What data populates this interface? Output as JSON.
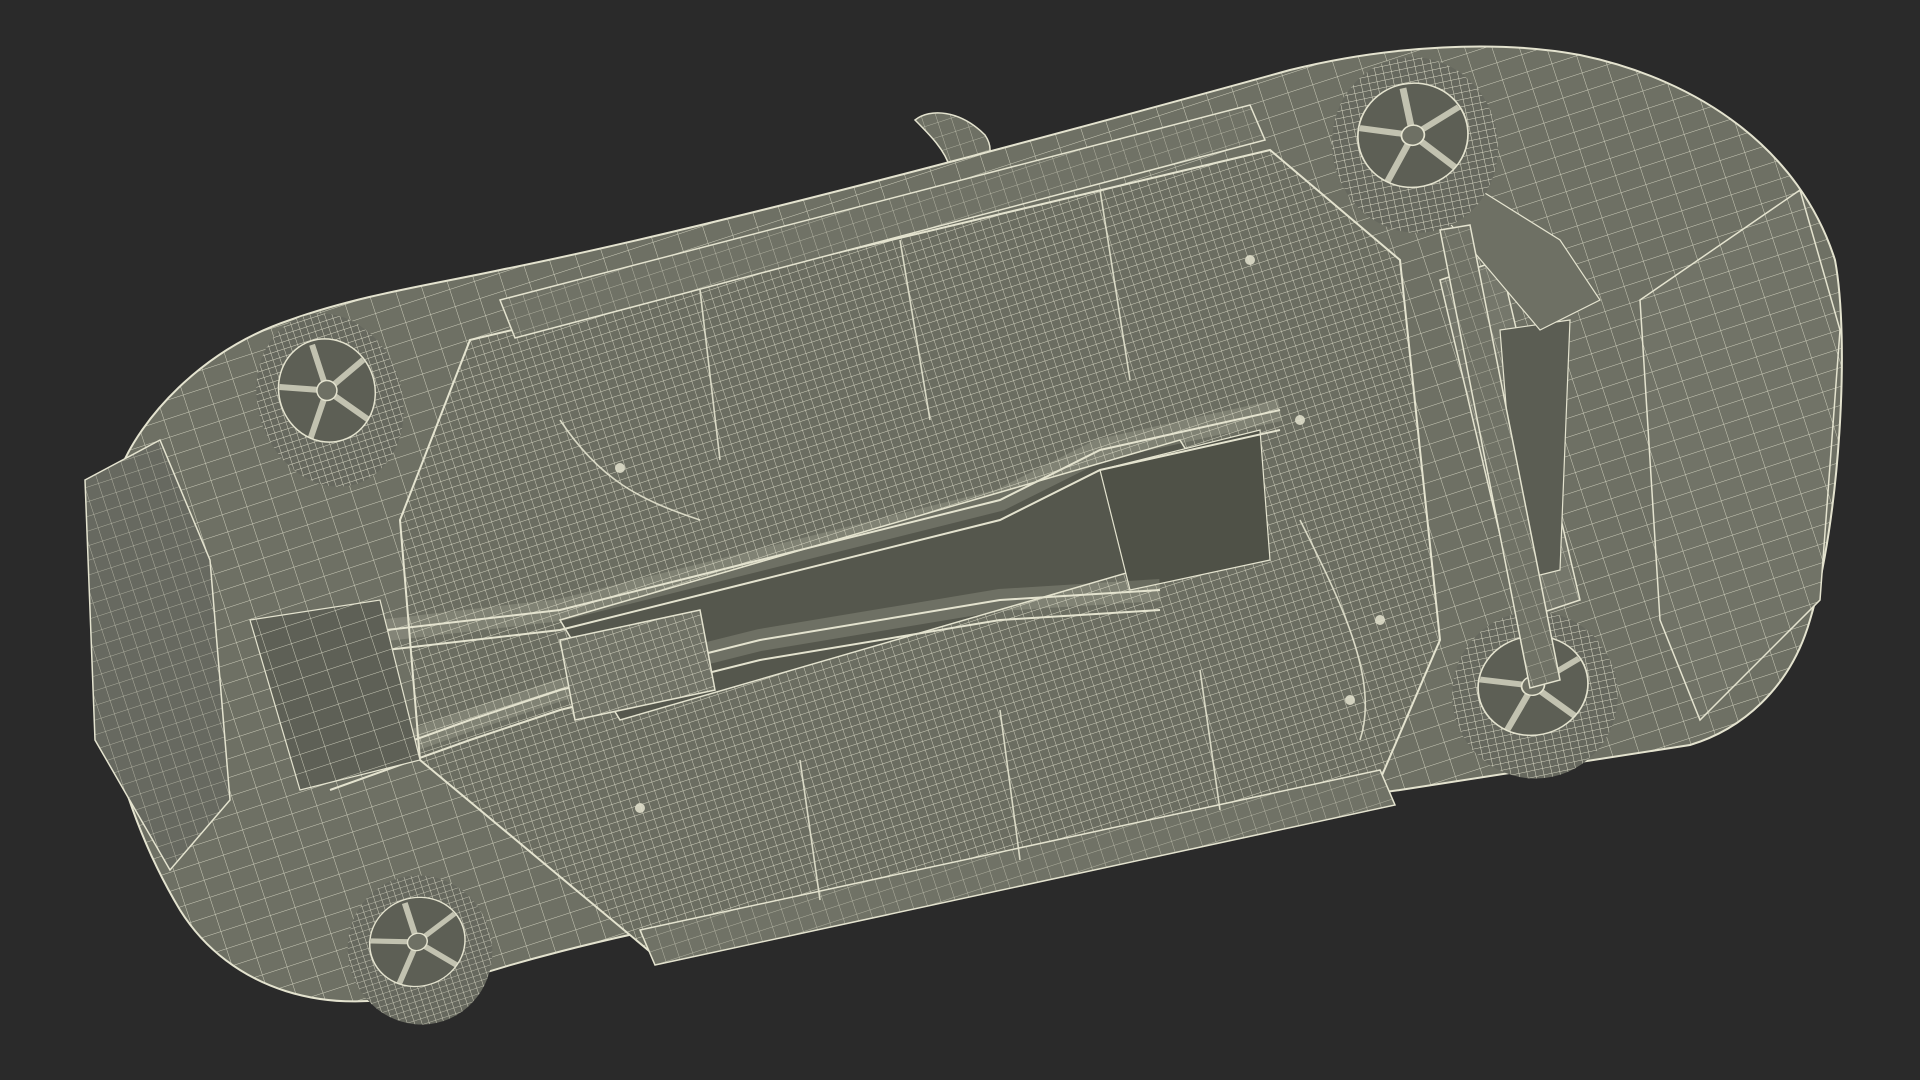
{
  "scene": {
    "background_color": "#2a2a2a",
    "mesh_fill_color": "#6e7064",
    "mesh_dark_color": "#55574d",
    "wire_color": "#e4e3cf",
    "tire_color": "#66685e"
  }
}
